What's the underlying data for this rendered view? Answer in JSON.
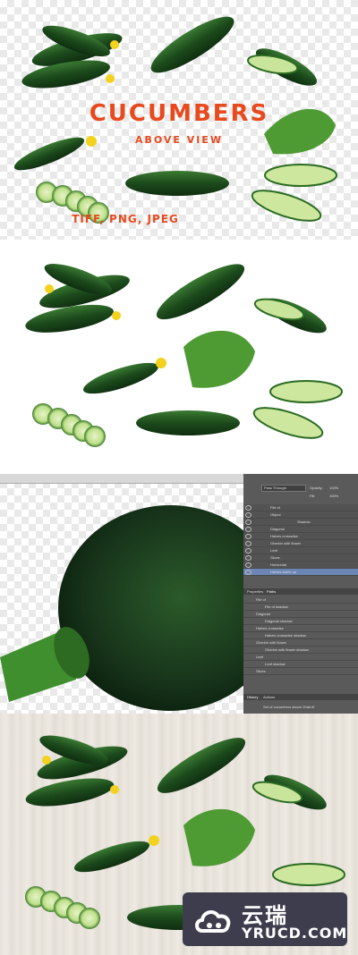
{
  "title_panel": {
    "heading": "CUCUMBERS",
    "subheading": "ABOVE VIEW",
    "formats": "TIFF, PNG, JPEG"
  },
  "photoshop": {
    "blend_mode": "Pass Through",
    "opacity_label": "Opacity:",
    "opacity_value": "100%",
    "fill_label": "Fill:",
    "fill_value": "100%",
    "layers": [
      "File of",
      "Object",
      "Shadow",
      "Diagonal",
      "Halves crosswise",
      "Gherkin with flower",
      "Leaf",
      "Slices",
      "Horizontal",
      "Halves swirls up"
    ],
    "tabs": [
      "Properties",
      "Paths"
    ],
    "paths": [
      "File of",
      "File of shadow",
      "Diagonal",
      "Diagonal shadow",
      "Halves crosswise",
      "Halves crosswise shadow",
      "Gherkin with flower",
      "Gherkin with flower shadow",
      "Leaf",
      "Leaf shadow",
      "Slices"
    ],
    "history_tabs": [
      "History",
      "Actions"
    ],
    "history_item": "Set of cucumbers above 20ab.tif"
  },
  "watermark": {
    "brand_cn": "云瑞",
    "brand_en": "YRUCD.COM"
  },
  "colors": {
    "accent": "#e8491d",
    "cucumber": "#1f4a1f",
    "badge_bg": "#3d3d4e"
  }
}
